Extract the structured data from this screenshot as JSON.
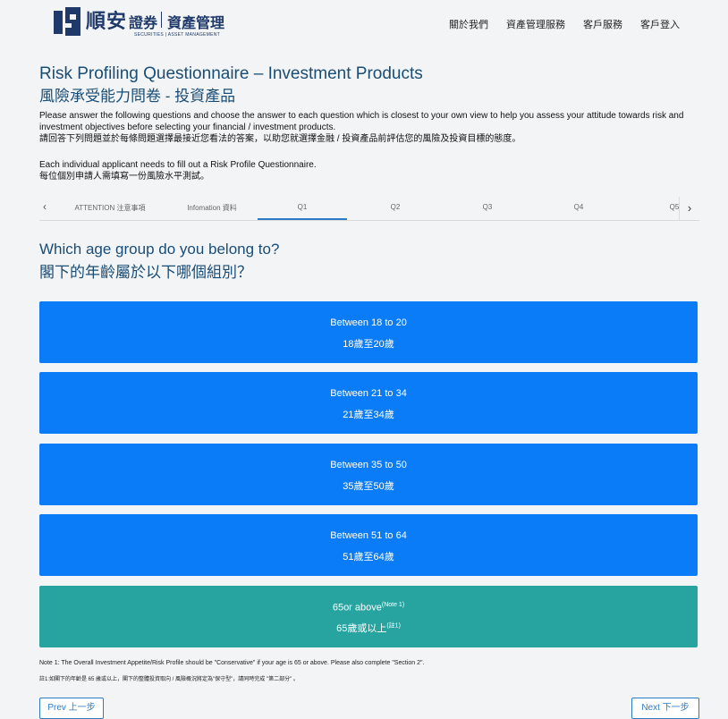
{
  "logo": {
    "name_cn": "順安",
    "name_cn2": "證券",
    "name_cn3": "資產管理",
    "sub": "SECURITIES | ASSET MANAGEMENT"
  },
  "nav": [
    "關於我們",
    "資產管理服務",
    "客戶服務",
    "客戶登入"
  ],
  "title": {
    "en": "Risk Profiling Questionnaire – Investment Products",
    "zh": "風險承受能力問卷 - 投資產品"
  },
  "intro": {
    "en": "Please answer the following questions and choose the answer to each question which is closest to your own view to help you assess your attitude towards risk and investment objectives before selecting your financial / investment products.",
    "zh": "請回答下列問題並於每條問題選擇最接近您看法的答案，以助您就選擇金融 / 投資產品前評估您的風險及投資目標的態度。",
    "en2": "Each individual applicant needs to fill out a Risk Profile Questionnaire.",
    "zh2": "每位個別申請人需填寫一份風險水平測試。"
  },
  "tabs": {
    "prev_icon": "chevron-left-icon",
    "next_icon": "chevron-right-icon",
    "items": [
      "ATTENTION 注意事項",
      "Infomation 資料",
      "Q1",
      "Q2",
      "Q3",
      "Q4",
      "Q5"
    ],
    "active": "Q1"
  },
  "question": {
    "en": "Which age group do you belong to?",
    "zh": "閣下的年齡屬於以下哪個組別？"
  },
  "options": [
    {
      "en": "Between 18 to 20",
      "zh": "18歲至20歲"
    },
    {
      "en": "Between 21 to 34",
      "zh": "21歲至34歲"
    },
    {
      "en": "Between 35 to 50",
      "zh": "35歲至50歲"
    },
    {
      "en": "Between 51 to 64",
      "zh": "51歲至64歲"
    },
    {
      "en": "65or above",
      "en_sup": "(Note 1)",
      "zh": "65歲或以上",
      "zh_sup": "(註1)"
    }
  ],
  "notes": {
    "en": "Note 1: The Overall Investment Appetite/Risk Profile should be \"Conservative\" if your age is 65 or above. Please also complete \"Section 2\".",
    "zh": "註1:如閣下的年齡是 65 歲或以上，閣下的整體投資取向 / 風險概況將定為\"保守型\"，請同時完成 \"第二部分\" 。"
  },
  "buttons": {
    "prev": "Prev 上一步",
    "next": "Next 下一步"
  },
  "colors": {
    "option_blue": "#0a7cf7",
    "option_selected": "#27a3a0",
    "title": "#1a4d76",
    "accent": "#2c7bc7"
  }
}
